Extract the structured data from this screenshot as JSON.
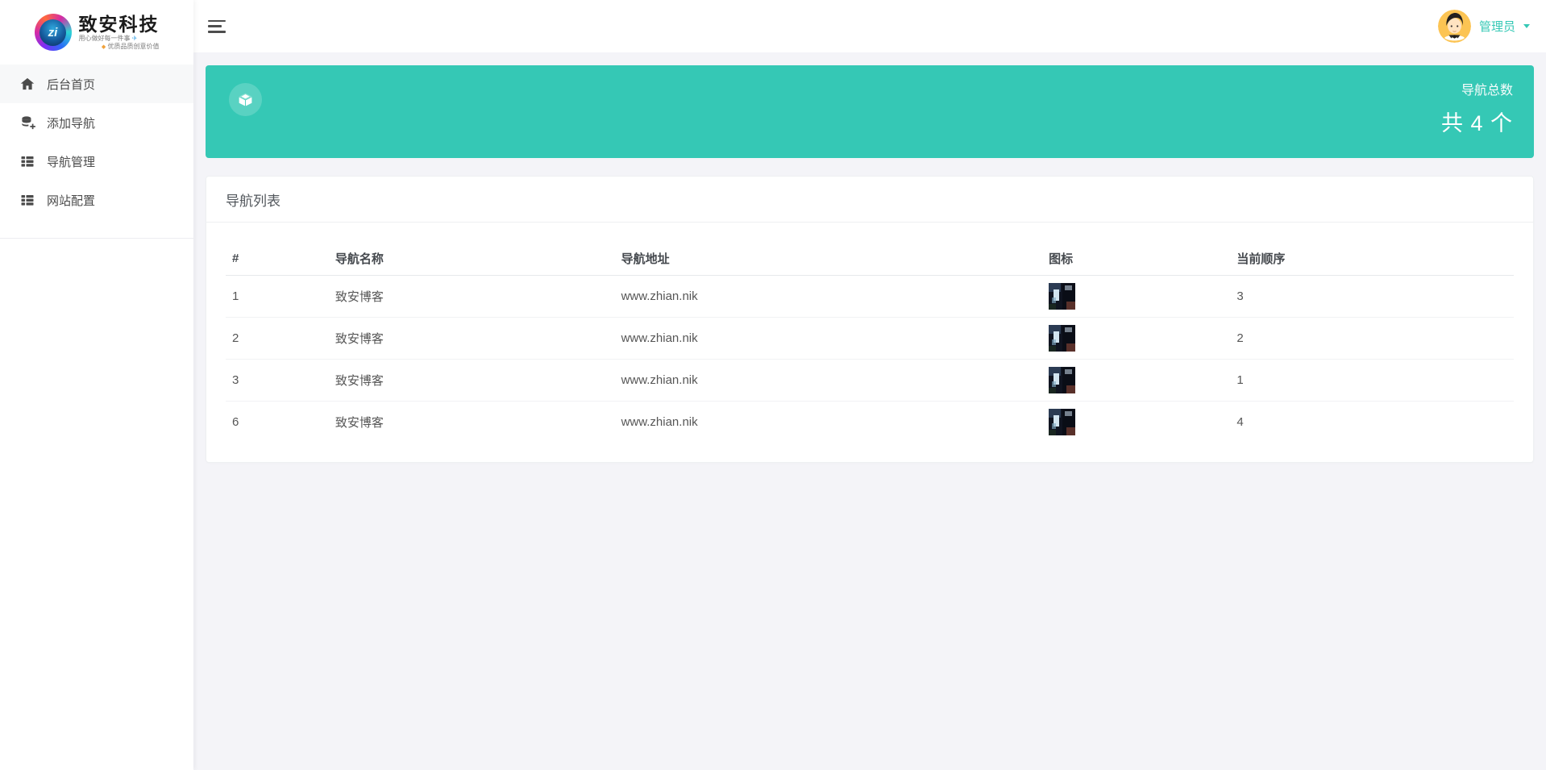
{
  "app": {
    "accent_color": "#35c8b5",
    "page_background": "#f4f4f8"
  },
  "sidebar": {
    "logo": {
      "badge_text": "zi",
      "title": "致安科技",
      "tagline1": "用心做好每一件事",
      "tagline2": "优质品质创意价值"
    },
    "items": [
      {
        "label": "后台首页",
        "icon": "home-icon",
        "active": true
      },
      {
        "label": "添加导航",
        "icon": "database-plus-icon",
        "active": false
      },
      {
        "label": "导航管理",
        "icon": "list-icon",
        "active": false
      },
      {
        "label": "网站配置",
        "icon": "list-icon",
        "active": false
      }
    ]
  },
  "topbar": {
    "menu_toggle": "hamburger-icon",
    "user": {
      "name": "管理员",
      "avatar": "cartoon-man-avatar"
    }
  },
  "banner": {
    "icon": "cube-icon",
    "stat_label": "导航总数",
    "stat_value": "共 4 个"
  },
  "nav_list": {
    "title": "导航列表",
    "columns": [
      "#",
      "导航名称",
      "导航地址",
      "图标",
      "当前顺序"
    ],
    "rows": [
      {
        "id": "1",
        "name": "致安博客",
        "url": "www.zhian.nik",
        "icon": "site-thumbnail",
        "order": "3"
      },
      {
        "id": "2",
        "name": "致安博客",
        "url": "www.zhian.nik",
        "icon": "site-thumbnail",
        "order": "2"
      },
      {
        "id": "3",
        "name": "致安博客",
        "url": "www.zhian.nik",
        "icon": "site-thumbnail",
        "order": "1"
      },
      {
        "id": "6",
        "name": "致安博客",
        "url": "www.zhian.nik",
        "icon": "site-thumbnail",
        "order": "4"
      }
    ]
  }
}
